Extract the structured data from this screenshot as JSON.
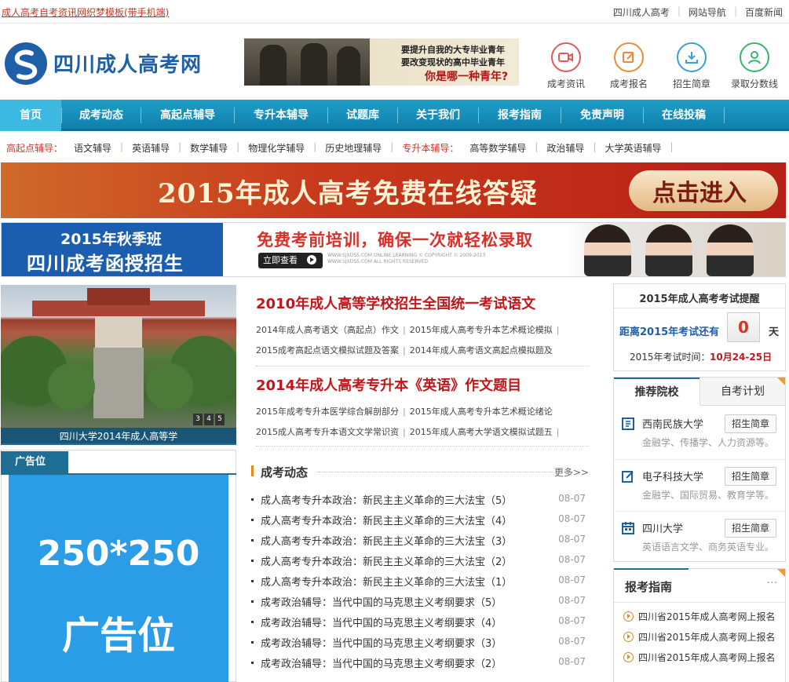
{
  "topbar": {
    "site_link": "成人高考自考资讯网织梦模板(带手机端)",
    "links": [
      "四川成人高考",
      "网站导航",
      "百度新闻"
    ]
  },
  "header": {
    "logo_text": "四川成人高考网",
    "banner_lines": [
      "要提升自我的大专毕业青年",
      "要改变现状的高中毕业青年",
      "你是哪一种青年?"
    ],
    "icons": [
      {
        "label": "成考资讯",
        "icon": "video-icon",
        "color": "#e05a5a"
      },
      {
        "label": "成考报名",
        "icon": "edit-icon",
        "color": "#f08a3a"
      },
      {
        "label": "招生简章",
        "icon": "download-icon",
        "color": "#3aa0d8"
      },
      {
        "label": "录取分数线",
        "icon": "user-icon",
        "color": "#3ab56a"
      }
    ]
  },
  "nav": {
    "items": [
      "首页",
      "成考动态",
      "高起点辅导",
      "专升本辅导",
      "试题库",
      "关于我们",
      "报考指南",
      "免责声明",
      "在线投稿"
    ]
  },
  "subnav": {
    "cat1": "高起点辅导：",
    "items1": [
      "语文辅导",
      "英语辅导",
      "数学辅导",
      "物理化学辅导",
      "历史地理辅导"
    ],
    "cat2": "专升本辅导：",
    "items2": [
      "高等数学辅导",
      "政治辅导",
      "大学英语辅导"
    ]
  },
  "banner1": {
    "text": "2015年成人高考免费在线答疑",
    "button": "点击进入"
  },
  "banner2": {
    "line1": "2015年秋季班",
    "line2": "四川成考函授招生",
    "slogan": "免费考前培训，确保一次就轻松录取",
    "button": "立即查看",
    "small_text": "WWW.SJXDSS.COM ONLINE LEARNING © COPYRIGHT © 2009-2013 WWW.SJXDSS.COM ALL RIGHTS RESERVED"
  },
  "slideshow": {
    "caption": "四川大学2014年成人高等学",
    "nums": [
      "3",
      "4",
      "5"
    ]
  },
  "ad": {
    "tab": "广告位",
    "size": "250*250",
    "label": "广告位"
  },
  "headline1": {
    "title": "2010年成人高等学校招生全国统一考试语文",
    "row1": [
      "2014年成人高考语文（高起点）作文",
      "2015年成人高考专升本艺术概论模拟"
    ],
    "row2": [
      "2015成考高起点语文模拟试题及答案",
      "2014年成人高考语文高起点模拟题及"
    ]
  },
  "headline2": {
    "title": "2014年成人高考专升本《英语》作文题目",
    "row1": [
      "2015年成考专升本医学综合解剖部分",
      "2015年成人高考专升本艺术概论绪论"
    ],
    "row2": [
      "2015成人高考专升本语文文学常识资",
      "2015年成人高考大学语文模拟试题五"
    ]
  },
  "news": {
    "title": "成考动态",
    "more": "更多>>",
    "items": [
      {
        "title": "成人高考专升本政治：新民主主义革命的三大法宝（5）",
        "date": "08-07"
      },
      {
        "title": "成人高考专升本政治：新民主主义革命的三大法宝（4）",
        "date": "08-07"
      },
      {
        "title": "成人高考专升本政治：新民主主义革命的三大法宝（3）",
        "date": "08-07"
      },
      {
        "title": "成人高考专升本政治：新民主主义革命的三大法宝（2）",
        "date": "08-07"
      },
      {
        "title": "成人高考专升本政治：新民主主义革命的三大法宝（1）",
        "date": "08-07"
      },
      {
        "title": "成考政治辅导：当代中国的马克思主义考纲要求（5）",
        "date": "08-07"
      },
      {
        "title": "成考政治辅导：当代中国的马克思主义考纲要求（4）",
        "date": "08-07"
      },
      {
        "title": "成考政治辅导：当代中国的马克思主义考纲要求（3）",
        "date": "08-07"
      },
      {
        "title": "成考政治辅导：当代中国的马克思主义考纲要求（2）",
        "date": "08-07"
      }
    ]
  },
  "exam": {
    "title": "2015年成人高考考试提醒",
    "label": "距离2015年考试还有",
    "count": "0",
    "unit": "天",
    "date_label": "2015年考试时间：",
    "date_value": "10月24-25日"
  },
  "schools": {
    "tabs": [
      "推荐院校",
      "自考计划"
    ],
    "items": [
      {
        "name": "西南民族大学",
        "button": "招生简章",
        "sub": "金融学、传播学、人力资源等。",
        "icon": "book-icon"
      },
      {
        "name": "电子科技大学",
        "button": "招生简章",
        "sub": "金融学、国际贸易、教育学等。",
        "icon": "edit-icon"
      },
      {
        "name": "四川大学",
        "button": "招生简章",
        "sub": "英语语言文学、商务英语专业。",
        "icon": "calendar-icon"
      }
    ]
  },
  "guide": {
    "title": "报考指南",
    "more": "···",
    "items": [
      "四川省2015年成人高考网上报名",
      "四川省2015年成人高考网上报名",
      "四川省2015年成人高考网上报名"
    ]
  }
}
